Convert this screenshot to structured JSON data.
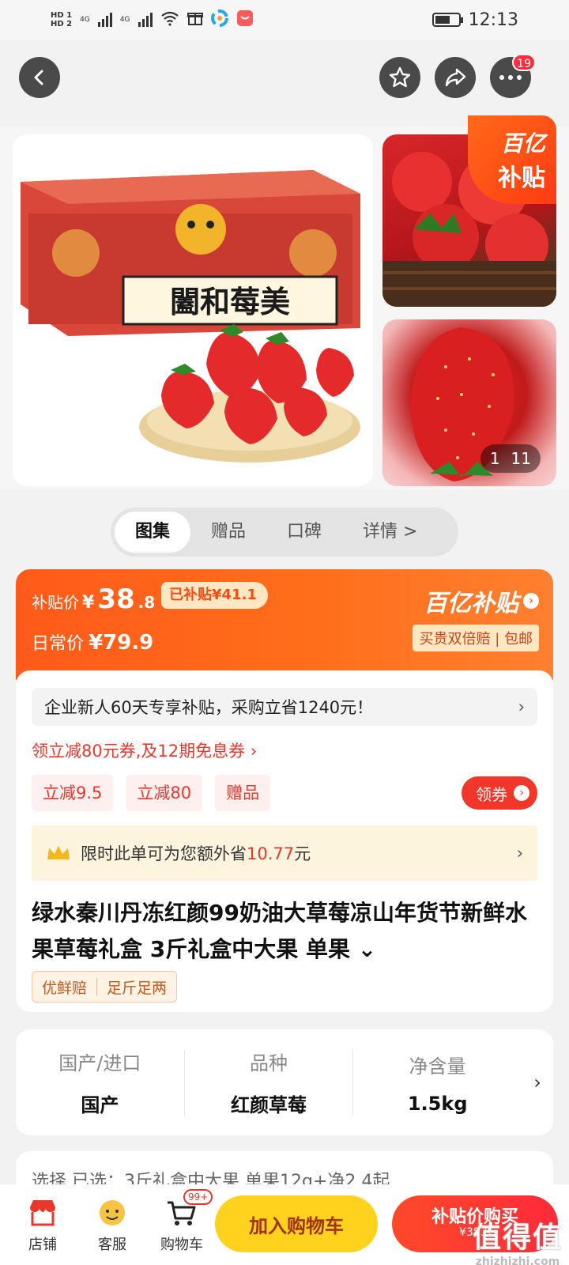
{
  "status": {
    "hd1": "HD 1",
    "hd2": "HD 2",
    "net1": "4G",
    "net2": "4G",
    "time": "12:13"
  },
  "nav": {
    "back_icon": "chevron-left-icon",
    "favorite_icon": "star-icon",
    "share_icon": "share-icon",
    "more_icon": "more-icon",
    "more_badge": "19"
  },
  "gallery": {
    "corner_line1": "百亿",
    "corner_line2": "补贴",
    "page_current": "1",
    "page_total": "11",
    "box_text": "闔和莓美"
  },
  "tabs": [
    {
      "label": "图集"
    },
    {
      "label": "赠品"
    },
    {
      "label": "口碑"
    },
    {
      "label": "详情 >"
    }
  ],
  "price": {
    "subsidy_label": "补贴价",
    "yen": "¥",
    "subsidy_int": "38",
    "subsidy_dec": ".8",
    "subsidized_tag": "已补贴¥41.1",
    "regular_label": "日常价",
    "regular_value": "¥79.9",
    "brand": "百亿补贴",
    "brand_sub": "买贵双倍赔 | 包邮"
  },
  "info": {
    "new_user": "企业新人60天专享补贴，采购立省1240元！",
    "coupon_line": "领立减80元券,及12期免息券 ›",
    "chips": [
      "立减9.5",
      "立减80",
      "赠品"
    ],
    "get_coupon": "领券",
    "saving_prefix": "限时此单可为您额外省",
    "saving_amount": "10.77",
    "saving_suffix": "元",
    "title": "绿水秦川丹冻红颜99奶油大草莓凉山年货节新鲜水果草莓礼盒 3斤礼盒中大果 单果 ⌄",
    "guarantee": [
      "优鲜赔",
      "足斤足两"
    ]
  },
  "attributes": [
    {
      "key": "国产/进口",
      "value": "国产"
    },
    {
      "key": "品种",
      "value": "红颜草莓"
    },
    {
      "key": "净含量",
      "value": "1.5kg"
    }
  ],
  "select_row": "选择    已选：3斤礼盒中大果 单果12g+净2.4起",
  "bottom": {
    "store": "店铺",
    "service": "客服",
    "cart": "购物车",
    "cart_badge": "99+",
    "add_cart": "加入购物车",
    "buy": "补贴价购买",
    "buy_price": "¥38.8",
    "watermark1": "值得值",
    "watermark2": "zhizhizhi.com"
  },
  "colors": {
    "accent": "#ff5a1a",
    "red": "#e8372c",
    "yellow": "#ffd21e"
  }
}
